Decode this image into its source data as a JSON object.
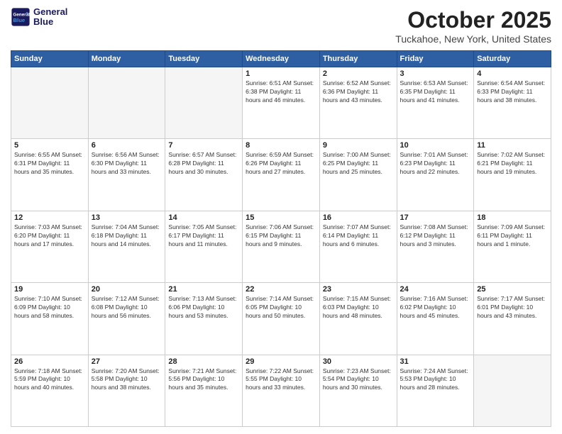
{
  "header": {
    "logo_line1": "General",
    "logo_line2": "Blue",
    "month": "October 2025",
    "location": "Tuckahoe, New York, United States"
  },
  "weekdays": [
    "Sunday",
    "Monday",
    "Tuesday",
    "Wednesday",
    "Thursday",
    "Friday",
    "Saturday"
  ],
  "weeks": [
    [
      {
        "day": "",
        "text": ""
      },
      {
        "day": "",
        "text": ""
      },
      {
        "day": "",
        "text": ""
      },
      {
        "day": "1",
        "text": "Sunrise: 6:51 AM\nSunset: 6:38 PM\nDaylight: 11 hours\nand 46 minutes."
      },
      {
        "day": "2",
        "text": "Sunrise: 6:52 AM\nSunset: 6:36 PM\nDaylight: 11 hours\nand 43 minutes."
      },
      {
        "day": "3",
        "text": "Sunrise: 6:53 AM\nSunset: 6:35 PM\nDaylight: 11 hours\nand 41 minutes."
      },
      {
        "day": "4",
        "text": "Sunrise: 6:54 AM\nSunset: 6:33 PM\nDaylight: 11 hours\nand 38 minutes."
      }
    ],
    [
      {
        "day": "5",
        "text": "Sunrise: 6:55 AM\nSunset: 6:31 PM\nDaylight: 11 hours\nand 35 minutes."
      },
      {
        "day": "6",
        "text": "Sunrise: 6:56 AM\nSunset: 6:30 PM\nDaylight: 11 hours\nand 33 minutes."
      },
      {
        "day": "7",
        "text": "Sunrise: 6:57 AM\nSunset: 6:28 PM\nDaylight: 11 hours\nand 30 minutes."
      },
      {
        "day": "8",
        "text": "Sunrise: 6:59 AM\nSunset: 6:26 PM\nDaylight: 11 hours\nand 27 minutes."
      },
      {
        "day": "9",
        "text": "Sunrise: 7:00 AM\nSunset: 6:25 PM\nDaylight: 11 hours\nand 25 minutes."
      },
      {
        "day": "10",
        "text": "Sunrise: 7:01 AM\nSunset: 6:23 PM\nDaylight: 11 hours\nand 22 minutes."
      },
      {
        "day": "11",
        "text": "Sunrise: 7:02 AM\nSunset: 6:21 PM\nDaylight: 11 hours\nand 19 minutes."
      }
    ],
    [
      {
        "day": "12",
        "text": "Sunrise: 7:03 AM\nSunset: 6:20 PM\nDaylight: 11 hours\nand 17 minutes."
      },
      {
        "day": "13",
        "text": "Sunrise: 7:04 AM\nSunset: 6:18 PM\nDaylight: 11 hours\nand 14 minutes."
      },
      {
        "day": "14",
        "text": "Sunrise: 7:05 AM\nSunset: 6:17 PM\nDaylight: 11 hours\nand 11 minutes."
      },
      {
        "day": "15",
        "text": "Sunrise: 7:06 AM\nSunset: 6:15 PM\nDaylight: 11 hours\nand 9 minutes."
      },
      {
        "day": "16",
        "text": "Sunrise: 7:07 AM\nSunset: 6:14 PM\nDaylight: 11 hours\nand 6 minutes."
      },
      {
        "day": "17",
        "text": "Sunrise: 7:08 AM\nSunset: 6:12 PM\nDaylight: 11 hours\nand 3 minutes."
      },
      {
        "day": "18",
        "text": "Sunrise: 7:09 AM\nSunset: 6:11 PM\nDaylight: 11 hours\nand 1 minute."
      }
    ],
    [
      {
        "day": "19",
        "text": "Sunrise: 7:10 AM\nSunset: 6:09 PM\nDaylight: 10 hours\nand 58 minutes."
      },
      {
        "day": "20",
        "text": "Sunrise: 7:12 AM\nSunset: 6:08 PM\nDaylight: 10 hours\nand 56 minutes."
      },
      {
        "day": "21",
        "text": "Sunrise: 7:13 AM\nSunset: 6:06 PM\nDaylight: 10 hours\nand 53 minutes."
      },
      {
        "day": "22",
        "text": "Sunrise: 7:14 AM\nSunset: 6:05 PM\nDaylight: 10 hours\nand 50 minutes."
      },
      {
        "day": "23",
        "text": "Sunrise: 7:15 AM\nSunset: 6:03 PM\nDaylight: 10 hours\nand 48 minutes."
      },
      {
        "day": "24",
        "text": "Sunrise: 7:16 AM\nSunset: 6:02 PM\nDaylight: 10 hours\nand 45 minutes."
      },
      {
        "day": "25",
        "text": "Sunrise: 7:17 AM\nSunset: 6:01 PM\nDaylight: 10 hours\nand 43 minutes."
      }
    ],
    [
      {
        "day": "26",
        "text": "Sunrise: 7:18 AM\nSunset: 5:59 PM\nDaylight: 10 hours\nand 40 minutes."
      },
      {
        "day": "27",
        "text": "Sunrise: 7:20 AM\nSunset: 5:58 PM\nDaylight: 10 hours\nand 38 minutes."
      },
      {
        "day": "28",
        "text": "Sunrise: 7:21 AM\nSunset: 5:56 PM\nDaylight: 10 hours\nand 35 minutes."
      },
      {
        "day": "29",
        "text": "Sunrise: 7:22 AM\nSunset: 5:55 PM\nDaylight: 10 hours\nand 33 minutes."
      },
      {
        "day": "30",
        "text": "Sunrise: 7:23 AM\nSunset: 5:54 PM\nDaylight: 10 hours\nand 30 minutes."
      },
      {
        "day": "31",
        "text": "Sunrise: 7:24 AM\nSunset: 5:53 PM\nDaylight: 10 hours\nand 28 minutes."
      },
      {
        "day": "",
        "text": ""
      }
    ]
  ]
}
